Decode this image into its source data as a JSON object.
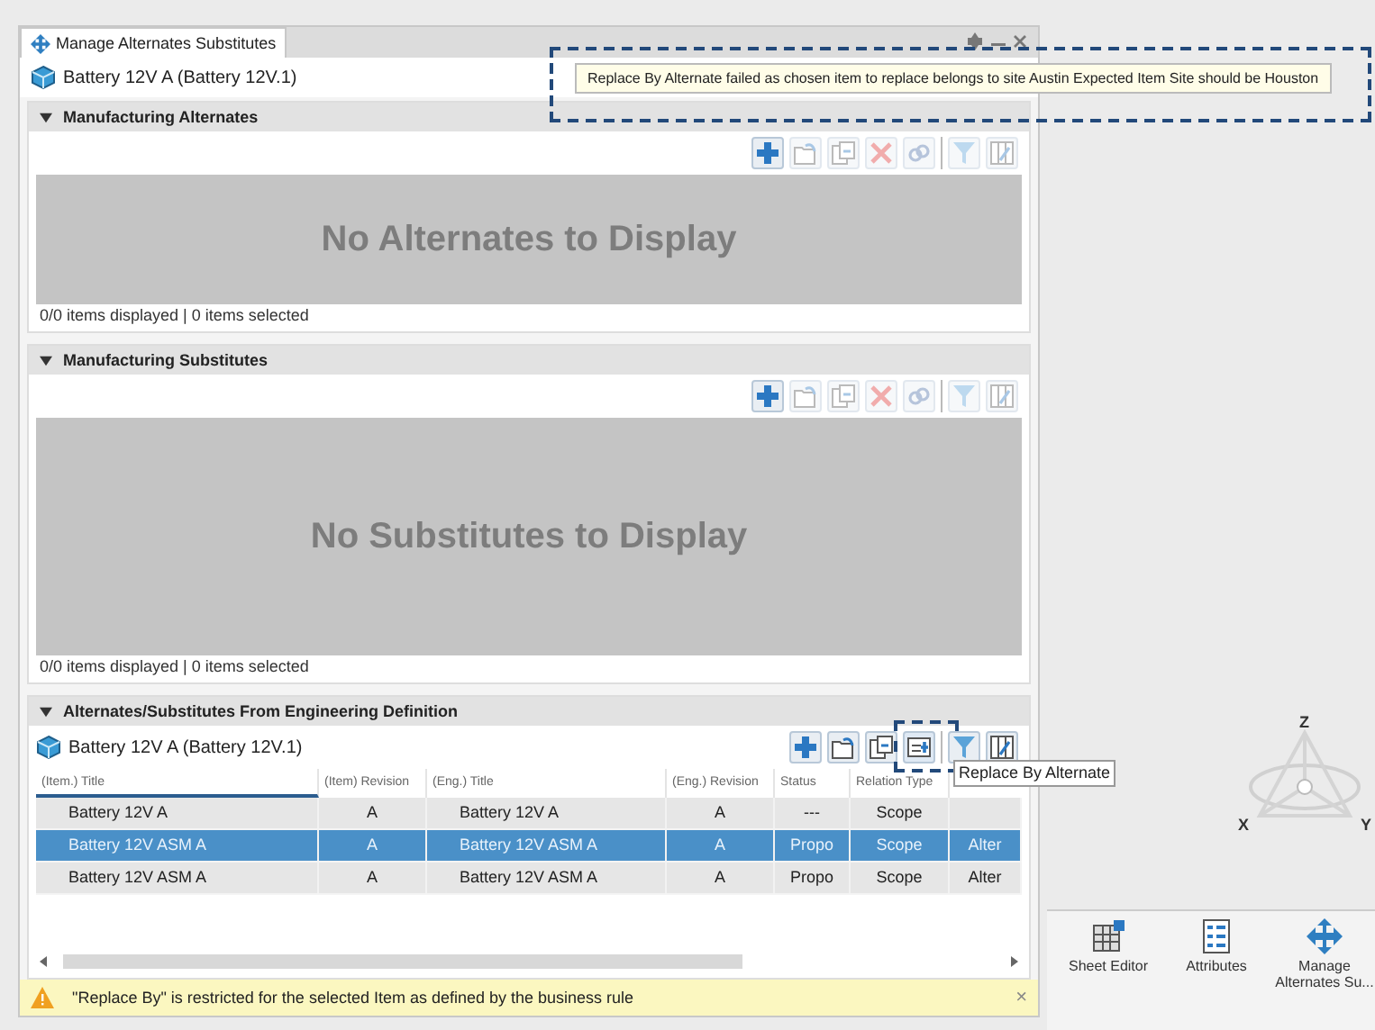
{
  "tab": {
    "label": "Manage Alternates Substitutes"
  },
  "item": {
    "label": "Battery 12V A (Battery 12V.1)"
  },
  "error_tooltip": {
    "text": "Replace By Alternate failed as chosen item to replace belongs to site Austin Expected Item Site should be Houston"
  },
  "sections": [
    {
      "title": "Manufacturing Alternates",
      "expanded": true,
      "kind": "empty",
      "toolbar": [
        {
          "kind": "add",
          "disabled": false,
          "highlighted": false
        },
        {
          "kind": "insert",
          "disabled": true,
          "highlighted": false
        },
        {
          "kind": "copy",
          "disabled": true,
          "highlighted": false
        },
        {
          "kind": "delete",
          "disabled": true,
          "highlighted": false
        },
        {
          "kind": "link",
          "disabled": true,
          "highlighted": false
        },
        {
          "kind": "filter",
          "disabled": true,
          "highlighted": false
        },
        {
          "kind": "columns",
          "disabled": true,
          "highlighted": false
        }
      ],
      "empty_message": "No Alternates to Display",
      "status": "0/0 items displayed | 0 items selected"
    },
    {
      "title": "Manufacturing Substitutes",
      "expanded": true,
      "kind": "empty",
      "toolbar": [
        {
          "kind": "add",
          "disabled": false,
          "highlighted": false
        },
        {
          "kind": "insert",
          "disabled": true,
          "highlighted": false
        },
        {
          "kind": "copy",
          "disabled": true,
          "highlighted": false
        },
        {
          "kind": "delete",
          "disabled": true,
          "highlighted": false
        },
        {
          "kind": "link",
          "disabled": true,
          "highlighted": false
        },
        {
          "kind": "filter",
          "disabled": true,
          "highlighted": false
        },
        {
          "kind": "columns",
          "disabled": true,
          "highlighted": false
        }
      ],
      "empty_message": "No Substitutes to Display",
      "status": "0/0 items displayed | 0 items selected"
    },
    {
      "title": "Alternates/Substitutes From Engineering Definition",
      "expanded": true,
      "kind": "table",
      "item_label": "Battery 12V A (Battery 12V.1)",
      "toolbar": [
        {
          "kind": "add",
          "disabled": false,
          "highlighted": false
        },
        {
          "kind": "insert",
          "disabled": false,
          "highlighted": false
        },
        {
          "kind": "copy",
          "disabled": false,
          "highlighted": false
        },
        {
          "kind": "replace",
          "disabled": false,
          "highlighted": true,
          "tooltip": "Replace By Alternate"
        },
        {
          "kind": "filter",
          "disabled": false,
          "highlighted": false
        },
        {
          "kind": "columns",
          "disabled": false,
          "highlighted": false
        }
      ],
      "table": {
        "columns": [
          "(Item.) Title",
          "(Item) Revision",
          "(Eng.) Title",
          "(Eng.) Revision",
          "Status",
          "Relation Type"
        ],
        "rows": [
          {
            "cells": [
              "Battery 12V A",
              "A",
              "Battery 12V A",
              "A",
              "---",
              "Scope",
              ""
            ],
            "selected": false
          },
          {
            "cells": [
              "Battery 12V ASM A",
              "A",
              "Battery 12V ASM A",
              "A",
              "Propo",
              "Scope",
              "Alter"
            ],
            "selected": true
          },
          {
            "cells": [
              "Battery 12V ASM A",
              "A",
              "Battery 12V ASM A",
              "A",
              "Propo",
              "Scope",
              "Alter"
            ],
            "selected": false
          }
        ]
      }
    }
  ],
  "warning": {
    "text": "\"Replace By\" is restricted for the selected Item as defined by the business rule",
    "close": "×"
  },
  "axis": {
    "labels": [
      "Z",
      "X",
      "Y"
    ]
  },
  "commands": [
    {
      "label": "Sheet Editor",
      "kind": "sheet"
    },
    {
      "label": "Attributes",
      "kind": "list"
    },
    {
      "label": "Manage Alternates Su...",
      "kind": "cross"
    }
  ]
}
